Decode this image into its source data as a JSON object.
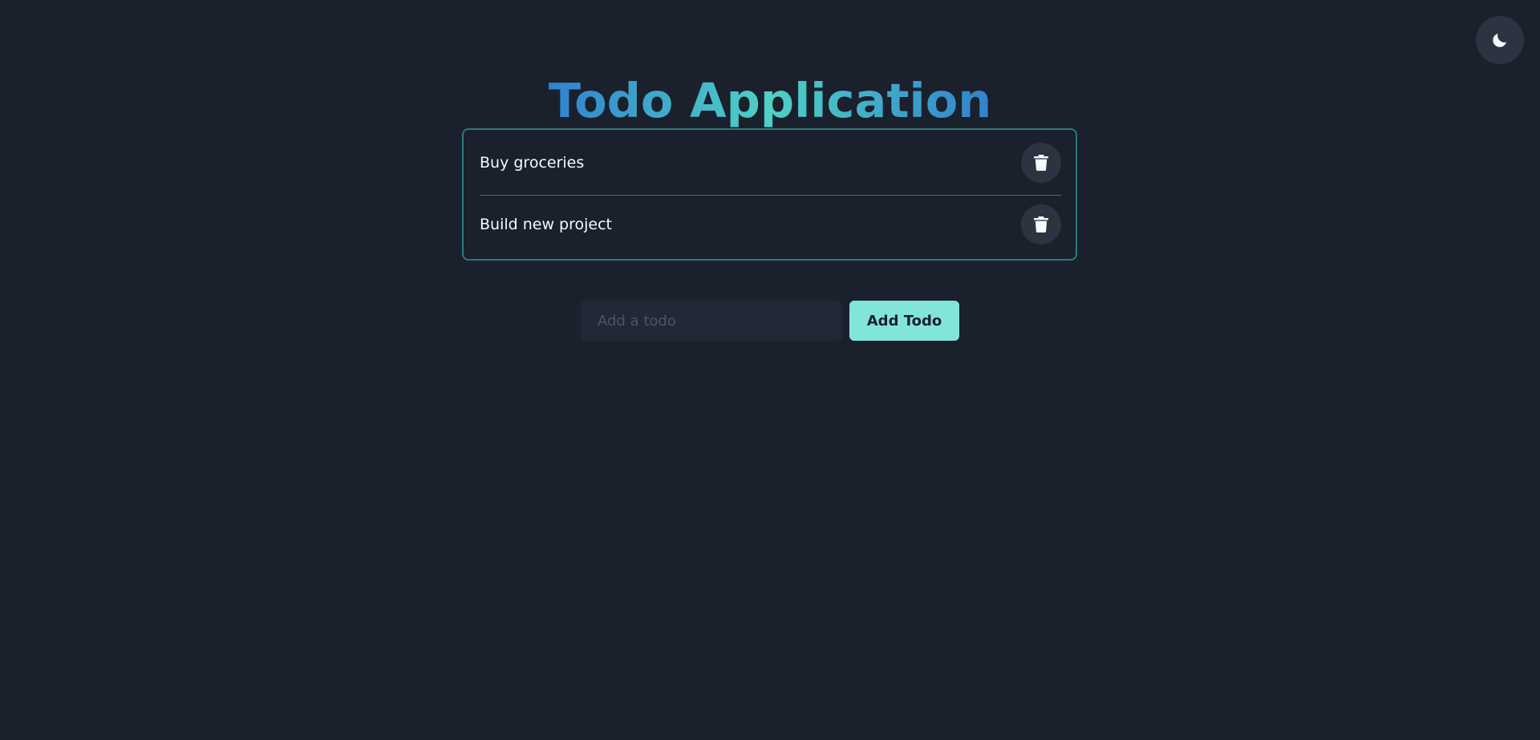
{
  "header": {
    "title": "Todo Application",
    "theme_toggle_icon": "moon-icon"
  },
  "todos": [
    {
      "text": "Buy groceries",
      "action_icon": "trash-icon"
    },
    {
      "text": "Build new project",
      "action_icon": "trash-icon"
    }
  ],
  "form": {
    "input_value": "",
    "input_placeholder": "Add a todo",
    "add_label": "Add Todo"
  },
  "colors": {
    "background": "#1a202c",
    "accent": "#81e6d9",
    "border": "#2c7a7b",
    "title_gradient": [
      "#3182ce",
      "#4fd1c5"
    ]
  }
}
